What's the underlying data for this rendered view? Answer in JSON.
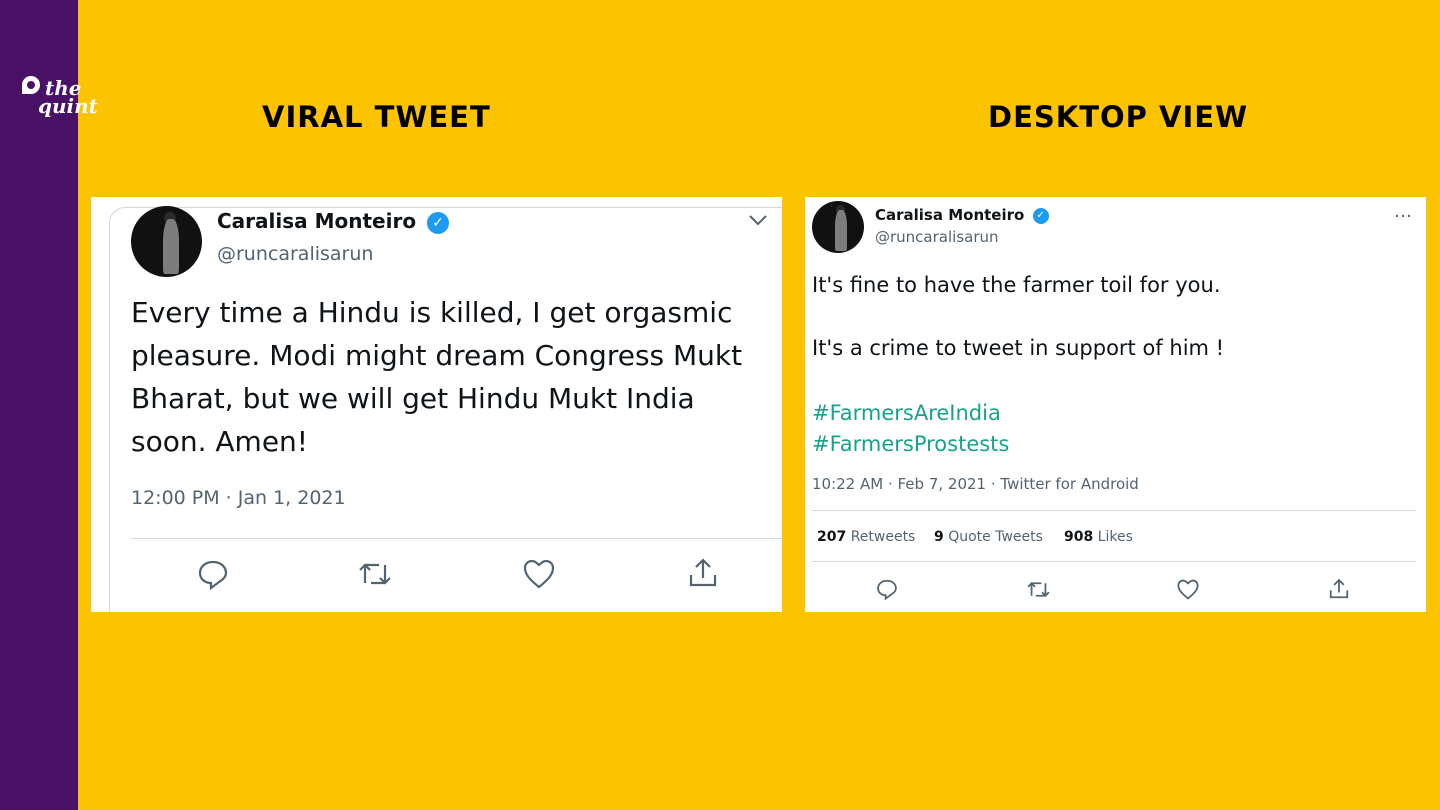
{
  "brand": {
    "logo_line1": "the",
    "logo_line2": "quint"
  },
  "headings": {
    "left": "VIRAL TWEET",
    "right": "DESKTOP VIEW"
  },
  "viral_tweet": {
    "name": "Caralisa Monteiro",
    "handle": "@runcaralisarun",
    "text": "Every time a Hindu is killed, I get orgasmic pleasure. Modi might dream Congress Mukt Bharat, but we will get Hindu Mukt India soon. Amen!",
    "timestamp": "12:00 PM · Jan 1, 2021"
  },
  "desktop_tweet": {
    "name": "Caralisa Monteiro",
    "handle": "@runcaralisarun",
    "line1": "It's fine to have the farmer toil for you.",
    "line2": "It's a crime to tweet in support of him !",
    "hashtags": [
      "#FarmersAreIndia",
      "#FarmersProstests"
    ],
    "timestamp": "10:22 AM · Feb 7, 2021 · Twitter for Android",
    "stats": {
      "retweets_count": "207",
      "retweets_label": "Retweets",
      "quotes_count": "9",
      "quotes_label": "Quote Tweets",
      "likes_count": "908",
      "likes_label": "Likes"
    },
    "more_icon": "…"
  },
  "colors": {
    "background": "#fcc400",
    "sidebar": "#4a1266",
    "verified": "#1d9bf0",
    "hashtag": "#17a38b"
  }
}
